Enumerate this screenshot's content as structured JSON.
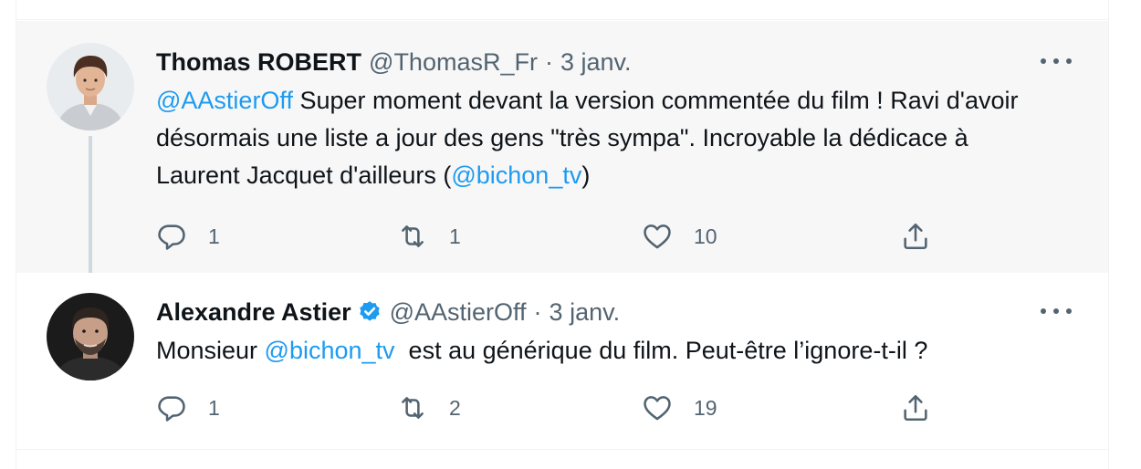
{
  "tweets": [
    {
      "author_name": "Thomas ROBERT",
      "handle": "@ThomasR_Fr",
      "separator": "·",
      "date": "3 janv.",
      "verified": false,
      "text_parts": [
        {
          "text": "@AAstierOff",
          "link": true
        },
        {
          "text": " Super moment devant la version commentée du film ! Ravi d'avoir désormais une liste a jour des gens \"très sympa\". Incroyable la dédicace à Laurent Jacquet d'ailleurs (",
          "link": false
        },
        {
          "text": "@bichon_tv",
          "link": true
        },
        {
          "text": ")",
          "link": false
        }
      ],
      "replies": "1",
      "retweets": "1",
      "likes": "10"
    },
    {
      "author_name": "Alexandre Astier",
      "handle": "@AAstierOff",
      "separator": "·",
      "date": "3 janv.",
      "verified": true,
      "text_parts": [
        {
          "text": "Monsieur ",
          "link": false
        },
        {
          "text": "@bichon_tv",
          "link": true
        },
        {
          "text": "  est au générique du film. Peut-être l’ignore-t-il ?",
          "link": false
        }
      ],
      "replies": "1",
      "retweets": "2",
      "likes": "19"
    }
  ],
  "icons": {
    "reply": "reply-icon",
    "retweet": "retweet-icon",
    "like": "heart-icon",
    "share": "share-icon",
    "more": "more-options-icon",
    "verified": "verified-badge-icon"
  },
  "colors": {
    "link": "#1d9bf0",
    "secondary_text": "#536471",
    "highlight_bg": "#f7f7f7",
    "thread_line": "#cfd9de"
  }
}
